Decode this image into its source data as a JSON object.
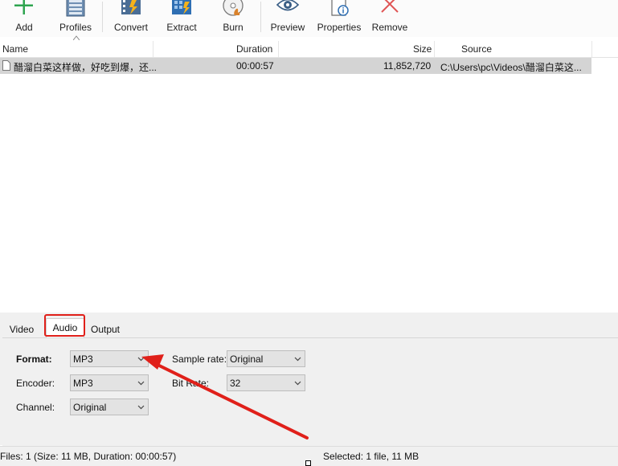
{
  "toolbar": {
    "buttons": [
      {
        "label": "Add",
        "icon": "plus-icon"
      },
      {
        "label": "Profiles",
        "icon": "profiles-icon"
      },
      {
        "label": "Convert",
        "icon": "convert-icon"
      },
      {
        "label": "Extract",
        "icon": "extract-icon"
      },
      {
        "label": "Burn",
        "icon": "burn-disc-icon"
      },
      {
        "label": "Preview",
        "icon": "eye-icon"
      },
      {
        "label": "Properties",
        "icon": "properties-icon"
      },
      {
        "label": "Remove",
        "icon": "remove-x-icon"
      }
    ]
  },
  "file_list": {
    "columns": {
      "name": "Name",
      "duration": "Duration",
      "size": "Size",
      "source": "Source"
    },
    "rows": [
      {
        "name": "醋溜白菜这样做，好吃到爆，还...",
        "duration": "00:00:57",
        "size": "11,852,720",
        "source": "C:\\Users\\pc\\Videos\\醋溜白菜这..."
      }
    ]
  },
  "settings_panel": {
    "tabs": [
      {
        "label": "Video",
        "active": false
      },
      {
        "label": "Audio",
        "active": true
      },
      {
        "label": "Output",
        "active": false
      }
    ],
    "fields": {
      "format": {
        "label": "Format:",
        "value": "MP3"
      },
      "encoder": {
        "label": "Encoder:",
        "value": "MP3"
      },
      "channel": {
        "label": "Channel:",
        "value": "Original"
      },
      "sample_rate": {
        "label": "Sample rate:",
        "value": "Original"
      },
      "bit_rate": {
        "label": "Bit Rate:",
        "value": "32"
      }
    }
  },
  "status_bar": {
    "files_info": "Files: 1 (Size: 11 MB, Duration: 00:00:57)",
    "selected_info": "Selected: 1 file, 11 MB"
  },
  "colors": {
    "accent_blue": "#2f6fb3",
    "highlight_red": "#e0201a",
    "add_green": "#2ea44f",
    "remove_red": "#e05555",
    "row_selected": "#d4d4d4"
  }
}
